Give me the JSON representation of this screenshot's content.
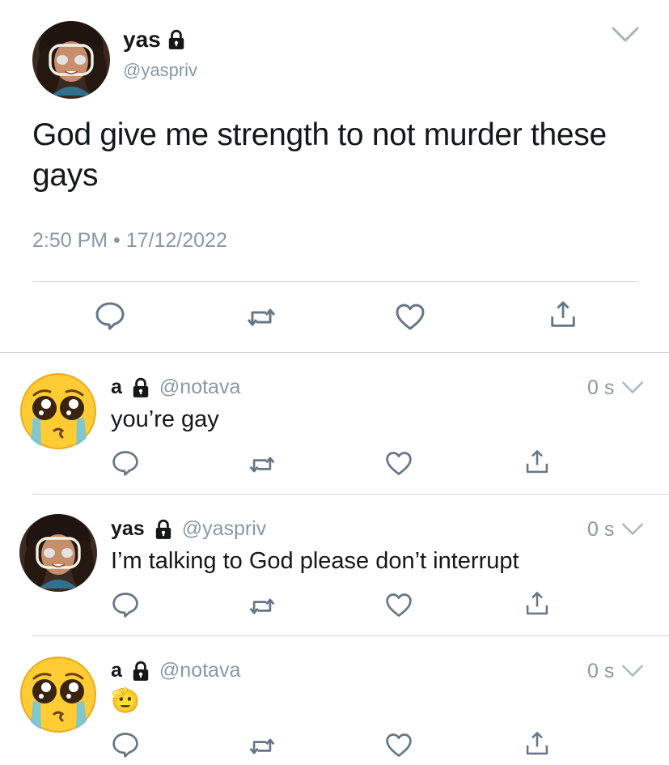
{
  "main_tweet": {
    "display_name": "yas",
    "handle": "@yaspriv",
    "text": "God give me strength to not murder these gays",
    "timestamp": "2:50 PM • 17/12/2022",
    "icons": [
      "lock-icon",
      "chevron-down-icon",
      "reply-icon",
      "retweet-icon",
      "like-icon",
      "share-icon"
    ]
  },
  "replies": [
    {
      "display_name": "a",
      "handle": "@notava",
      "age": "0 s",
      "text": "you’re gay",
      "avatar": "pleading-face-emoji"
    },
    {
      "display_name": "yas",
      "handle": "@yaspriv",
      "age": "0 s",
      "text": "I’m talking to God please don’t interrupt",
      "avatar": "user-photo"
    },
    {
      "display_name": "a",
      "handle": "@notava",
      "age": "0 s",
      "text": "🫡",
      "avatar": "pleading-face-emoji"
    }
  ],
  "colors": {
    "text": "#14171a",
    "secondary": "#8899a6",
    "icon": "#657786",
    "divider": "#d3d3d3"
  }
}
